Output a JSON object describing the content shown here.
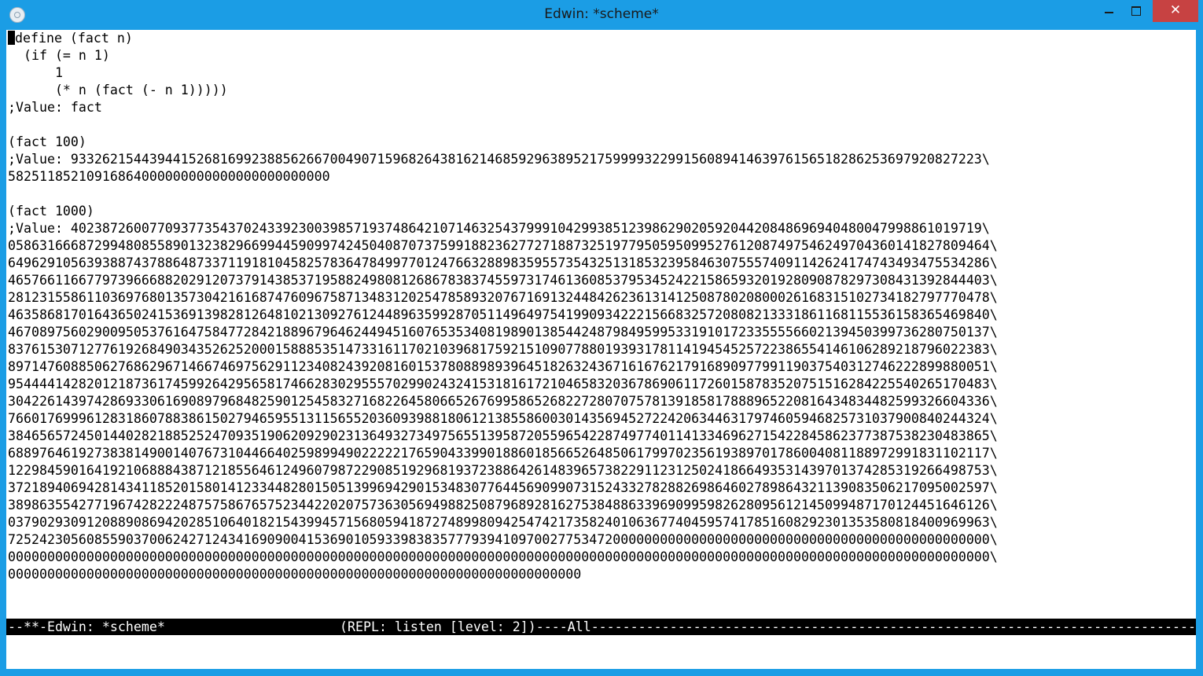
{
  "window": {
    "title": "Edwin: *scheme*",
    "icon": "edwin-app-icon",
    "controls": {
      "minimize": "minimize-icon",
      "maximize": "maximize-icon",
      "close": "✕"
    }
  },
  "buffer": {
    "cursor_char": "(",
    "text_after_cursor": "define (fact n)\n  (if (= n 1)\n      1\n      (* n (fact (- n 1)))))\n;Value: fact\n\n(fact 100)\n;Value: 93326215443944152681699238856266700490715968264381621468592963895217599993229915608941463976156518286253697920827223\\\n58251185210916864000000000000000000000000\n\n(fact 1000)\n;Value: 40238726007709377354370243392300398571937486421071463254379991042993851239862902059204420848696940480047998861019719\\\n05863166687299480855890132382966994459099742450408707375991882362772718873251977950595099527612087497546249704360141827809464\\\n64962910563938874378864873371191810458257836478499770124766328898359557354325131853239584630755574091142624174743493475534286\\\n46576611667797396668820291207379143853719588249808126867838374559731746136085379534524221586593201928090878297308431392844403\\\n28123155861103697680135730421616874760967587134831202547858932076716913244842623613141250878020800026168315102734182797770478\\\n46358681701643650241536913982812648102130927612448963599287051149649754199093422215668325720808213331861168115536158365469840\\\n46708975602900950537616475847728421889679646244945160765353408198901385442487984959953319101723355556602139450399736280750137\\\n83761530712776192684903435262520001588853514733161170210396817592151090778801939317811419454525722386554146106289218796022383\\\n89714760885062768629671466746975629112340824392081601537808898939645182632436716167621791689097799119037540312746222899880051\\\n95444414282012187361745992642956581746628302955570299024324153181617210465832036786906117260158783520751516284225540265170483\\\n30422614397428693306169089796848259012545832716822645806652676995865268227280707578139185817888965220816434834482599326604336\\\n76601769996128318607883861502794659551311565520360939881806121385586003014356945272242063446317974605946825731037900840244324\\\n38465657245014402821885252470935190620929023136493273497565513958720559654228749774011413346962715422845862377387538230483865\\\n68897646192738381490014076731044664025989949022222176590433990188601856652648506179970235619389701786004081188972991831102117\\\n12298459016419210688843871218556461249607987229085192968193723886426148396573822911231250241866493531439701374285319266498753\\\n37218940694281434118520158014123344828015051399694290153483077644569099073152433278288269864602789864321139083506217095002597\\\n38986355427719674282224875758676575234422020757363056949882508796892816275384886339690995982628095612145099487170124451646126\\\n03790293091208890869420285106401821543994571568059418727489980942547421735824010636774045957417851608292301353580818400969963\\\n72524230560855903700624271243416909004153690105933983835777939410970027753472000000000000000000000000000000000000000000000000\\\n00000000000000000000000000000000000000000000000000000000000000000000000000000000000000000000000000000000000000000000000000000\\\n0000000000000000000000000000000000000000000000000000000000000000000000000"
  },
  "mode_line": {
    "left": "--**-Edwin: *scheme*",
    "right": "(REPL: listen [level: 2])----All-----------------------------------------------------------------------------------"
  },
  "minibuffer": {
    "text": ""
  },
  "colors": {
    "titlebar": "#1b9de5",
    "close_button": "#c74242",
    "mode_line_bg": "#000000",
    "mode_line_fg": "#ffffff",
    "buffer_bg": "#ffffff"
  }
}
